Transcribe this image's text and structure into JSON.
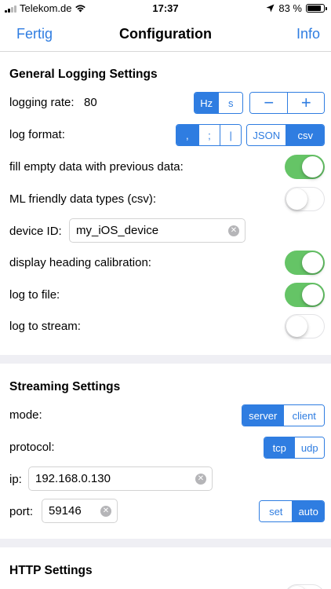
{
  "status_bar": {
    "carrier": "Telekom.de",
    "time": "17:37",
    "battery": "83 %",
    "icons": [
      "signal-icon",
      "wifi-icon",
      "location-arrow-icon",
      "battery-icon"
    ]
  },
  "nav": {
    "left": "Fertig",
    "title": "Configuration",
    "right": "Info"
  },
  "general": {
    "title": "General Logging Settings",
    "logging_rate_label": "logging rate:",
    "logging_rate_value": "80",
    "rate_unit_options": [
      "Hz",
      "s"
    ],
    "rate_unit_selected": "Hz",
    "stepper": [
      "−",
      "+"
    ],
    "log_format_label": "log format:",
    "separator_options": [
      ",",
      ";",
      "|"
    ],
    "separator_selected": ",",
    "format_options": [
      "JSON",
      "csv"
    ],
    "format_selected": "csv",
    "fill_empty_label": "fill empty data with previous data:",
    "fill_empty": true,
    "ml_types_label": "ML friendly data types (csv):",
    "ml_types": false,
    "device_id_label": "device ID:",
    "device_id_value": "my_iOS_device",
    "heading_cal_label": "display heading calibration:",
    "heading_cal": true,
    "log_file_label": "log to file:",
    "log_file": true,
    "log_stream_label": "log to stream:",
    "log_stream": false
  },
  "streaming": {
    "title": "Streaming Settings",
    "mode_label": "mode:",
    "mode_options": [
      "server",
      "client"
    ],
    "mode_selected": "server",
    "protocol_label": "protocol:",
    "protocol_options": [
      "tcp",
      "udp"
    ],
    "protocol_selected": "tcp",
    "ip_label": "ip:",
    "ip_value": "192.168.0.130",
    "port_label": "port:",
    "port_value": "59146",
    "port_options": [
      "set",
      "auto"
    ],
    "port_selected": "auto"
  },
  "http": {
    "title": "HTTP Settings"
  },
  "colors": {
    "accent": "#2f7de1",
    "toggle_on": "#65c466",
    "separator": "#efeff4"
  }
}
